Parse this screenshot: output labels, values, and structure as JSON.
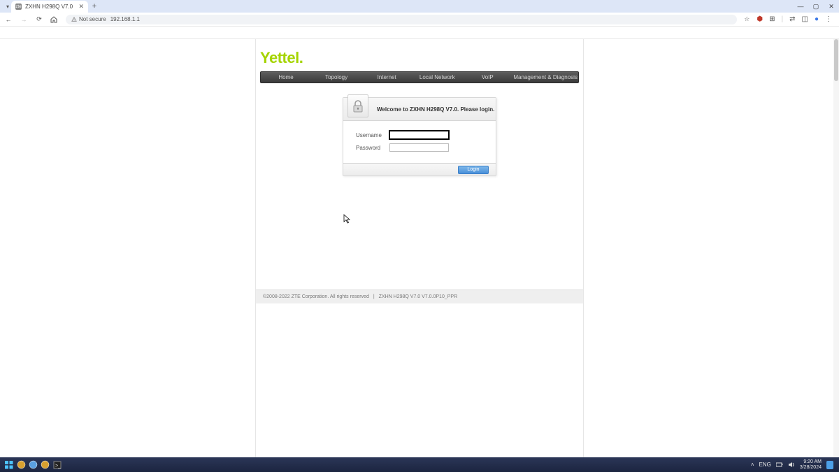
{
  "browser": {
    "tab_title": "ZXHN H298Q V7.0",
    "url": "192.168.1.1",
    "not_secure": "Not secure"
  },
  "page": {
    "brand": "Yettel",
    "menu": [
      "Home",
      "Topology",
      "Internet",
      "Local Network",
      "VoIP",
      "Management & Diagnosis"
    ],
    "welcome": "Welcome to ZXHN H298Q V7.0. Please login.",
    "labels": {
      "username": "Username",
      "password": "Password"
    },
    "login_button": "Login",
    "footer_copyright": "©2008-2022 ZTE Corporation. All rights reserved",
    "footer_sep": "|",
    "footer_model": "ZXHN H298Q V7.0 V7.0.0P10_PPR"
  },
  "taskbar": {
    "lang": "ENG",
    "time": "9:20 AM",
    "date": "3/28/2024"
  }
}
